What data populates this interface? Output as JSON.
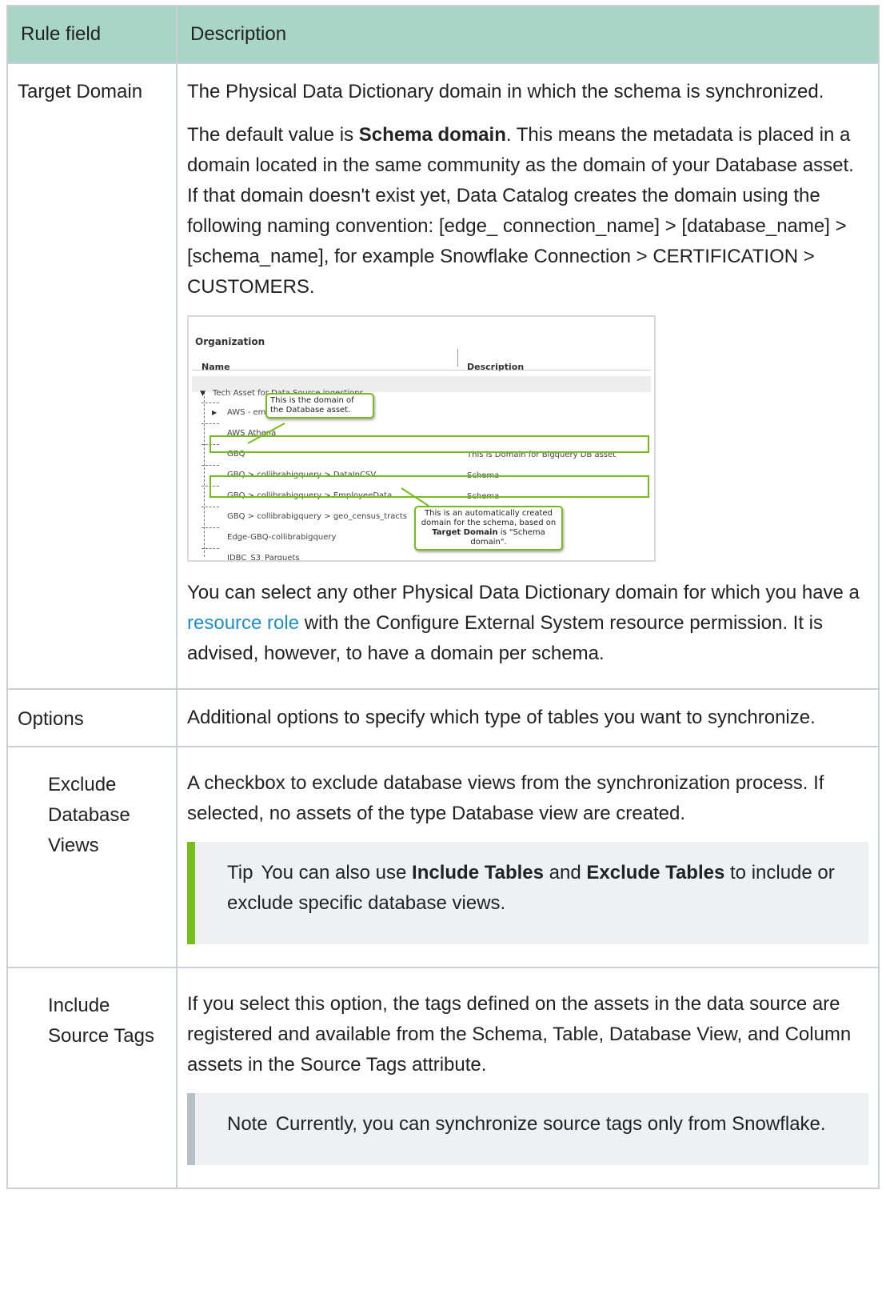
{
  "table": {
    "header_field": "Rule field",
    "header_desc": "Description"
  },
  "rows": {
    "target_domain": {
      "field": "Target Domain",
      "p1": "The Physical Data Dictionary domain in which the schema is synchronized.",
      "p2_before": "The default value is ",
      "p2_bold": "Schema domain",
      "p2_after": ". This means the metadata is placed in a domain located in the same community as the domain of your Database asset. If that domain doesn't exist yet, Data Catalog creates the domain using the following naming convention: [edge_ connection_name] > [database_name] > [schema_name], for example Snowflake Connection > CERTIFICATION > CUSTOMERS.",
      "p3_before": "You can select any other Physical Data Dictionary domain for which you have a ",
      "p3_link": "resource role",
      "p3_after": " with the Configure External System resource permission. It is advised, however, to have a domain per schema."
    },
    "options": {
      "field": "Options",
      "desc": "Additional options to specify which type of tables you want to synchronize."
    },
    "exclude_views": {
      "field": "Exclude Database Views",
      "desc": "A checkbox to exclude database views from the synchronization process. If selected, no assets of the type Database view are created.",
      "tip_label": "Tip",
      "tip_before": "You can also use ",
      "tip_bold1": "Include Tables",
      "tip_mid": " and ",
      "tip_bold2": "Exclude Tables",
      "tip_after": " to include or exclude specific database views."
    },
    "source_tags": {
      "field": "Include Source Tags",
      "desc": "If you select this option, the tags defined on the assets in the data source are registered and available from the Schema, Table, Database View, and Column assets in the Source Tags attribute.",
      "note_label": "Note",
      "note_text": "Currently, you can synchronize source tags only from Snowflake."
    }
  },
  "screenshot": {
    "title": "Organization",
    "col_name": "Name",
    "col_desc": "Description",
    "tree": [
      {
        "name": "Tech Asset for Data Source ingestions",
        "desc": ""
      },
      {
        "name": "AWS - eme",
        "desc": ""
      },
      {
        "name": "AWS Athena",
        "desc": ""
      },
      {
        "name": "GBQ",
        "desc": "This is Domain for Bigquery DB asset"
      },
      {
        "name": "GBQ > collibrabigquery > DataInCSV",
        "desc": "Schema"
      },
      {
        "name": "GBQ > collibrabigquery > EmployeeData",
        "desc": "Schema"
      },
      {
        "name": "GBQ > collibrabigquery > geo_census_tracts",
        "desc": ""
      },
      {
        "name": "Edge-GBQ-collibrabigquery",
        "desc": ""
      },
      {
        "name": "JDBC_S3_Parquets",
        "desc": ""
      }
    ],
    "bubble1": "This is the domain of the Database asset.",
    "bubble2_before": "This is an automatically created domain for the schema, based on ",
    "bubble2_bold": "Target Domain",
    "bubble2_after": " is \"Schema domain\"."
  }
}
